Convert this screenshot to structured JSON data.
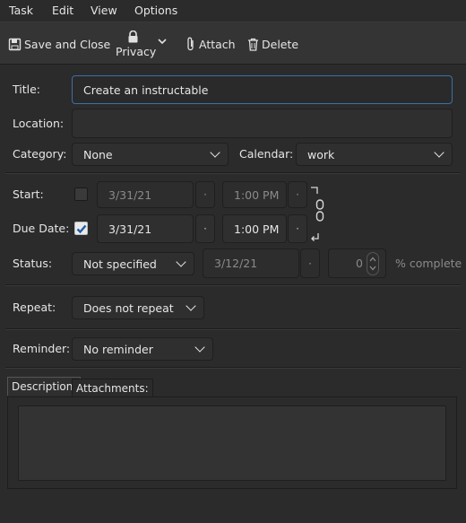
{
  "menu": {
    "items": [
      {
        "label": "Task",
        "mnemonic": "T"
      },
      {
        "label": "Edit",
        "mnemonic": "E"
      },
      {
        "label": "View",
        "mnemonic": "V"
      },
      {
        "label": "Options",
        "mnemonic": "O"
      }
    ]
  },
  "toolbar": {
    "save_close_label": "Save and Close",
    "privacy_label": "Privacy",
    "attach_label": "Attach",
    "delete_label": "Delete"
  },
  "form": {
    "title_label": "Title:",
    "title_value": "Create an instructable",
    "location_label": "Location:",
    "location_value": "",
    "category_label": "Category:",
    "category_value": "None",
    "calendar_label": "Calendar:",
    "calendar_value": "work",
    "start_label": "Start:",
    "start_checked": false,
    "start_date": "3/31/21",
    "start_time": "1:00 PM",
    "due_label": "Due Date:",
    "due_checked": true,
    "due_date": "3/31/21",
    "due_time": "1:00 PM",
    "status_label": "Status:",
    "status_value": "Not specified",
    "status_date": "3/12/21",
    "percent_value": "0",
    "percent_label": "% complete",
    "repeat_label": "Repeat:",
    "repeat_value": "Does not repeat",
    "reminder_label": "Reminder:",
    "reminder_value": "No reminder",
    "dot_glyph": "·"
  },
  "tabs": {
    "description_label": "Description:",
    "attachments_label": "Attachments:"
  },
  "colors": {
    "background": "#2b2b2b",
    "toolbar": "#343434",
    "focus_border": "#3d6fa8",
    "checkbox_checkmark": "#1f5fa8"
  }
}
